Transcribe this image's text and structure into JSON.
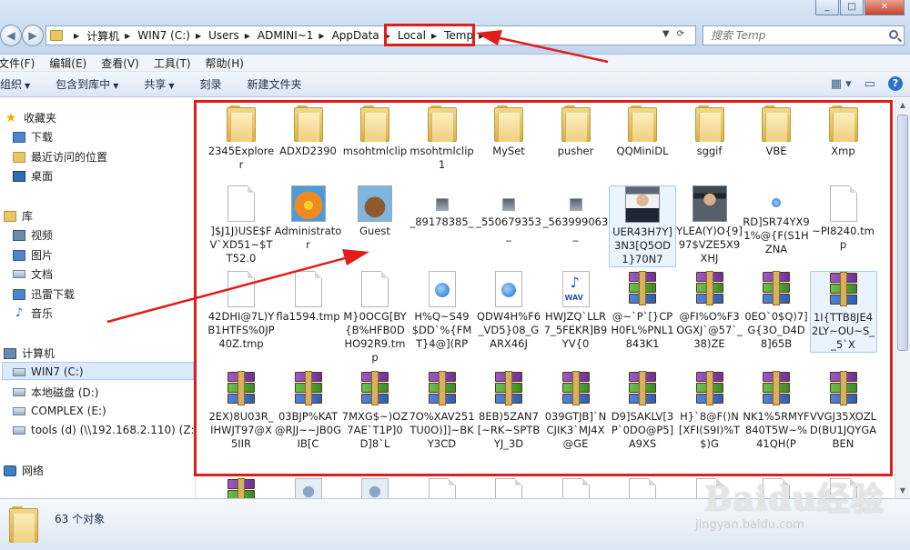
{
  "window": {
    "controls": [
      "minimize",
      "maximize",
      "close"
    ]
  },
  "nav": {
    "back_icon": "back-arrow-icon",
    "forward_icon": "forward-arrow-icon"
  },
  "breadcrumb": [
    "计算机",
    "WIN7 (C:)",
    "Users",
    "ADMINI~1",
    "AppData",
    "Local",
    "Temp"
  ],
  "search": {
    "placeholder": "搜索 Temp"
  },
  "menu": [
    "文件(F)",
    "编辑(E)",
    "查看(V)",
    "工具(T)",
    "帮助(H)"
  ],
  "toolbar": {
    "organize": "组织",
    "include_library": "包含到库中",
    "share": "共享",
    "burn": "刻录",
    "new_folder": "新建文件夹"
  },
  "sidebar": {
    "favorites": {
      "label": "收藏夹",
      "items": [
        "下载",
        "最近访问的位置",
        "桌面"
      ]
    },
    "libraries": {
      "label": "库",
      "items": [
        "视频",
        "图片",
        "文档",
        "迅雷下载",
        "音乐"
      ]
    },
    "computer": {
      "label": "计算机",
      "items": [
        "WIN7 (C:)",
        "本地磁盘 (D:)",
        "COMPLEX (E:)",
        "tools (d) (\\\\192.168.2.110) (Z:)"
      ]
    },
    "network": {
      "label": "网络"
    }
  },
  "files": [
    {
      "name": "2345Explorer",
      "type": "folder"
    },
    {
      "name": "ADXD2390",
      "type": "folder"
    },
    {
      "name": "msohtmlclip",
      "type": "folder"
    },
    {
      "name": "msohtmlclip1",
      "type": "folder"
    },
    {
      "name": "MySet",
      "type": "folder"
    },
    {
      "name": "pusher",
      "type": "folder"
    },
    {
      "name": "QQMiniDL",
      "type": "folder"
    },
    {
      "name": "sggif",
      "type": "folder"
    },
    {
      "name": "VBE",
      "type": "folder"
    },
    {
      "name": "Xmp",
      "type": "folder"
    },
    {
      "name": "]$J1J)USE$FV`XD51~$TT52.0",
      "type": "doc"
    },
    {
      "name": "Administrator",
      "type": "flower"
    },
    {
      "name": "Guest",
      "type": "case"
    },
    {
      "name": "_89178385_",
      "type": "mini"
    },
    {
      "name": "_550679353_",
      "type": "mini"
    },
    {
      "name": "_563999063_",
      "type": "mini"
    },
    {
      "name": "UER43H7Y]3N3[Q5OD1}70N7",
      "type": "person",
      "selected": true
    },
    {
      "name": "YLEA(Y)O{9]97$VZE5X9XHJ",
      "type": "person2"
    },
    {
      "name": "RD]SR74YX91%@{F(S1HZNA",
      "type": "tiny"
    },
    {
      "name": "~PI8240.tmp",
      "type": "doc"
    },
    {
      "name": "42DHI@7L)YB1HTFS%0JP40Z.tmp",
      "type": "doc"
    },
    {
      "name": "fla1594.tmp",
      "type": "doc"
    },
    {
      "name": "M}0OCG[BY{B%HFB0DHO92R9.tmp",
      "type": "doc"
    },
    {
      "name": "H%Q~S49$DD`%{FMT}4@](RP",
      "type": "ie"
    },
    {
      "name": "QDW4H%F6_VD5}08_GARX46J",
      "type": "ie"
    },
    {
      "name": "HWJZQ`LLR7_5FEKR]B9YV{0",
      "type": "wav"
    },
    {
      "name": "@~`P`[}CPH0FL%PNL1843K1",
      "type": "rar"
    },
    {
      "name": "@FI%O%F3OGXJ`@57`_38)ZE",
      "type": "rar"
    },
    {
      "name": "0EO`0$Q)7]G{3O_D4D8]65B",
      "type": "rar"
    },
    {
      "name": "1I{TTB8JE42LY~OU~S__5`X",
      "type": "rar",
      "selected": true
    },
    {
      "name": "2EX)8U03R_IHWJT97@X5IIR",
      "type": "rar"
    },
    {
      "name": "03BJP%KAT@RJJ~~JB0GIB[C",
      "type": "rar"
    },
    {
      "name": "7MXG$~)OZ7AE`T1P]0D]8`L",
      "type": "rar"
    },
    {
      "name": "7O%XAV251TU0O)]]~BKY3CD",
      "type": "rar"
    },
    {
      "name": "8EB)5ZAN7[~RK~SPTBYJ_3D",
      "type": "rar"
    },
    {
      "name": "039GTJB]`NCJIK3`MJ4X@GE",
      "type": "rar"
    },
    {
      "name": "D9]SAKLV[3P`0DO@P5]A9XS",
      "type": "rar"
    },
    {
      "name": "H}`8@F()N[XFI(S9I)%T$)G",
      "type": "rar"
    },
    {
      "name": "NK1%5RMYF840T5W~%41QH(P",
      "type": "rar"
    },
    {
      "name": "VVGJ35XOZLD(BU1JQYGABEN",
      "type": "rar"
    }
  ],
  "status": {
    "count": "63 个对象"
  },
  "watermark": {
    "logo": "Baidu经验",
    "url": "jingyan.baidu.com"
  },
  "colors": {
    "highlight": "#e21b1b",
    "selection": "#dcebfc"
  }
}
